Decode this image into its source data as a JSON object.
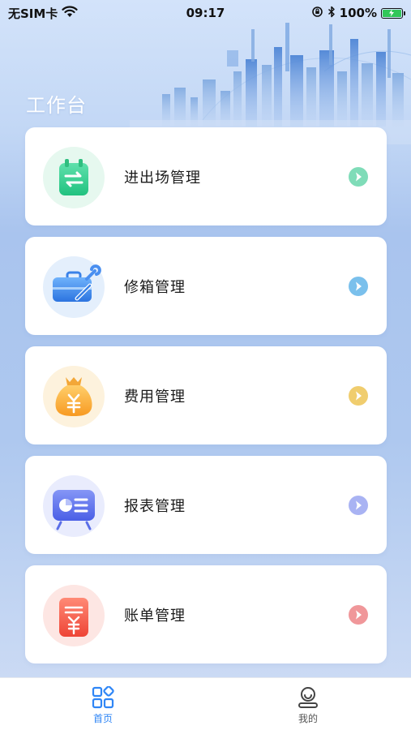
{
  "status_bar": {
    "carrier": "无SIM卡",
    "time": "09:17",
    "battery": "100%"
  },
  "header": {
    "title": "工作台"
  },
  "menu": {
    "items": [
      {
        "label": "进出场管理",
        "icon": "in-out-icon",
        "color": "#3ccf95",
        "arrow_color": "#7fdcb8"
      },
      {
        "label": "修箱管理",
        "icon": "toolbox-icon",
        "color": "#3f8ff2",
        "arrow_color": "#7ac0ec"
      },
      {
        "label": "费用管理",
        "icon": "money-bag-icon",
        "color": "#f7a12a",
        "arrow_color": "#f0cd6e"
      },
      {
        "label": "报表管理",
        "icon": "report-board-icon",
        "color": "#5f74ee",
        "arrow_color": "#a9b3f3"
      },
      {
        "label": "账单管理",
        "icon": "bill-icon",
        "color": "#f25445",
        "arrow_color": "#f0979a"
      }
    ]
  },
  "tab_bar": {
    "home_label": "首页",
    "mine_label": "我的",
    "active_color": "#2f86f6"
  }
}
